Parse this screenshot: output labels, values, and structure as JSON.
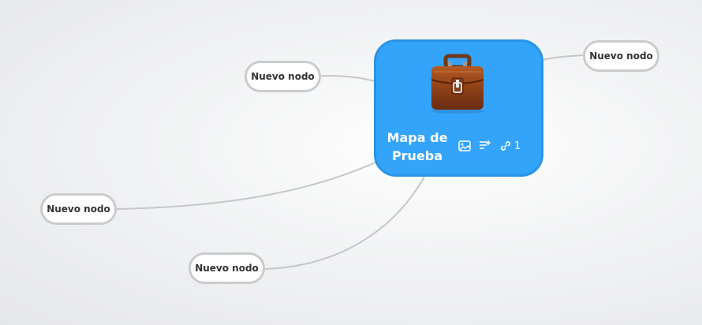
{
  "central_topic": {
    "title": "Mapa de Prueba",
    "icon": "briefcase-icon",
    "attachment_icons": [
      "image-icon",
      "notes-icon",
      "link-icon"
    ],
    "link_count": "1",
    "color": "#34a4fb"
  },
  "nodes": [
    {
      "label": "Nuevo nodo"
    },
    {
      "label": "Nuevo nodo"
    },
    {
      "label": "Nuevo nodo"
    },
    {
      "label": "Nuevo nodo"
    }
  ],
  "colors": {
    "connector": "#c4c6c8",
    "node_border": "#c9cbcd"
  }
}
